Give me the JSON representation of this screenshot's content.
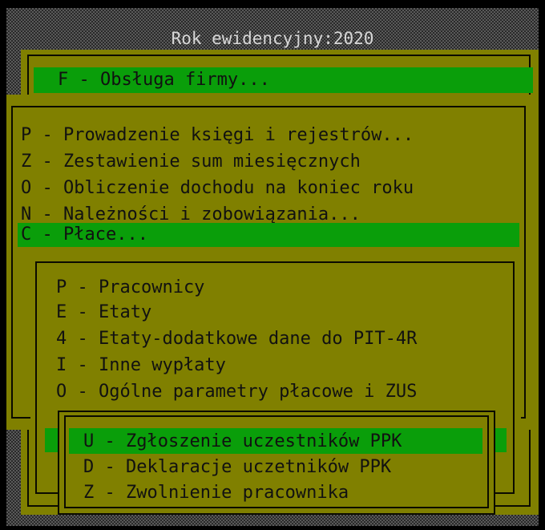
{
  "window": {
    "title": "Rok ewidencyjny:2020"
  },
  "top_menu": {
    "selected_item": "F - Obsługa firmy..."
  },
  "ksiega_menu": {
    "items": [
      {
        "key": "P",
        "label": "P - Prowadzenie księgi i rejestrów..."
      },
      {
        "key": "Z",
        "label": "Z - Zestawienie sum miesięcznych"
      },
      {
        "key": "O",
        "label": "O - Obliczenie dochodu na koniec roku"
      },
      {
        "key": "N",
        "label": "N - Należności i zobowiązania..."
      },
      {
        "key": "C",
        "label": "C - Płace..."
      }
    ],
    "selected_index": 4
  },
  "place_menu": {
    "items": [
      {
        "key": "P",
        "label": "P - Pracownicy"
      },
      {
        "key": "E",
        "label": "E - Etaty"
      },
      {
        "key": "4",
        "label": "4 - Etaty-dodatkowe dane do PIT-4R"
      },
      {
        "key": "I",
        "label": "I - Inne wypłaty"
      },
      {
        "key": "O",
        "label": "O - Ogólne parametry płacowe i ZUS"
      }
    ]
  },
  "ppk_menu": {
    "items": [
      {
        "key": "U",
        "label": "U - Zgłoszenie uczestników PPK"
      },
      {
        "key": "D",
        "label": "D - Deklaracje uczetników PPK"
      },
      {
        "key": "Z",
        "label": "Z - Zwolnienie pracownika"
      }
    ],
    "selected_index": 0
  },
  "colors": {
    "panel": "#808000",
    "highlight": "#0a9e0a",
    "frame_line": "#0b0b00",
    "title_text": "#d8d8d8",
    "background": "#000000"
  }
}
